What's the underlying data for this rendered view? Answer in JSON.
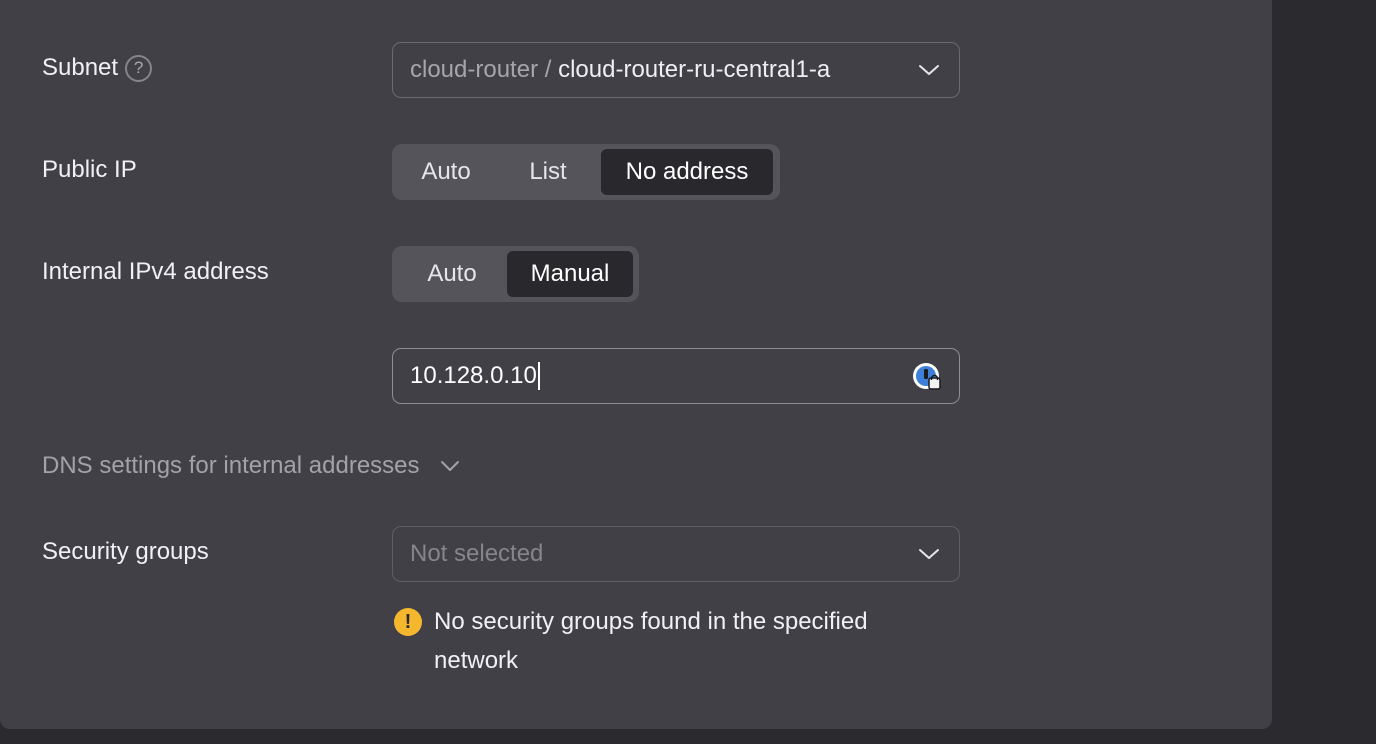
{
  "subnet": {
    "label": "Subnet",
    "help_symbol": "?",
    "network": "cloud-router",
    "separator": " / ",
    "value": "cloud-router-ru-central1-a"
  },
  "public_ip": {
    "label": "Public IP",
    "options": [
      "Auto",
      "List",
      "No address"
    ],
    "selected": "No address"
  },
  "internal_ipv4": {
    "label": "Internal IPv4 address",
    "options": [
      "Auto",
      "Manual"
    ],
    "selected": "Manual",
    "value": "10.128.0.10"
  },
  "dns": {
    "label": "DNS settings for internal addresses"
  },
  "security_groups": {
    "label": "Security groups",
    "placeholder": "Not selected",
    "warning_symbol": "!",
    "warning_text": "No security groups found in the specified network"
  },
  "colors": {
    "panel_background": "#414046",
    "page_background": "#2b2a2f",
    "active_segment": "#29282d",
    "warning": "#f5b72e",
    "password_manager_icon": "#3d7fd9"
  },
  "icons": {
    "help": "question-circle-icon",
    "dropdown": "chevron-down-icon",
    "password_manager": "password-manager-icon",
    "warning": "warning-circle-icon"
  }
}
